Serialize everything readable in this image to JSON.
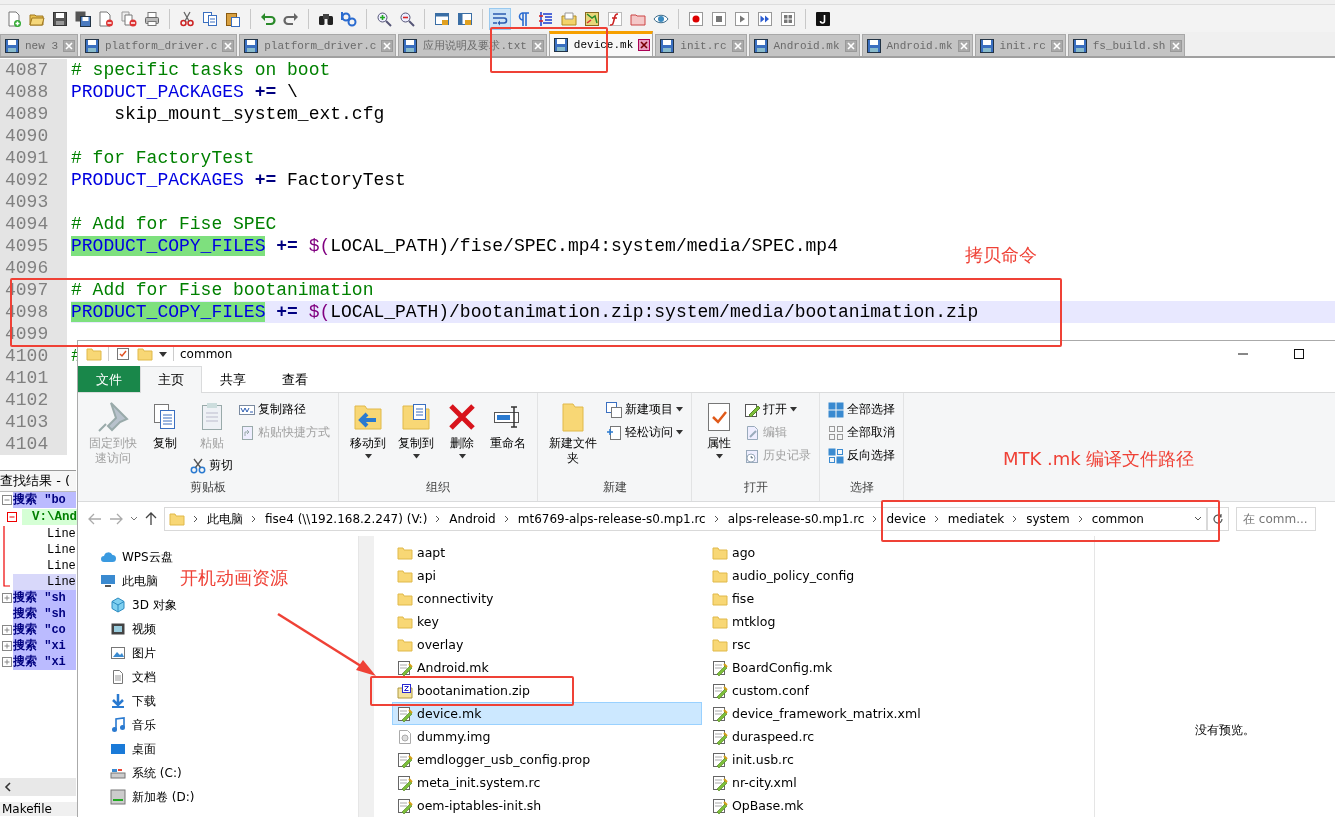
{
  "toolbar": {
    "wrap_toggle_on": true
  },
  "editor": {
    "tabs": [
      {
        "label": "new 3",
        "selected": false
      },
      {
        "label": "platform_driver.c",
        "selected": false
      },
      {
        "label": "platform_driver.c",
        "selected": false
      },
      {
        "label": "应用说明及要求.txt",
        "selected": false
      },
      {
        "label": "device.mk",
        "selected": true
      },
      {
        "label": "init.rc",
        "selected": false
      },
      {
        "label": "Android.mk",
        "selected": false
      },
      {
        "label": "Android.mk",
        "selected": false
      },
      {
        "label": "init.rc",
        "selected": false
      },
      {
        "label": "fs_build.sh",
        "selected": false
      }
    ],
    "lines": [
      {
        "number": "4087",
        "current": false,
        "segments": [
          {
            "kind": "comment",
            "text": "# specific tasks on boot"
          }
        ]
      },
      {
        "number": "4088",
        "current": false,
        "segments": [
          {
            "kind": "keyword",
            "text": "PRODUCT_PACKAGES"
          },
          {
            "kind": "operator",
            "text": "+="
          },
          {
            "kind": "plain",
            "text": "\\"
          }
        ]
      },
      {
        "number": "4089",
        "current": false,
        "segments": [
          {
            "kind": "plain",
            "text": "    skip_mount_system_ext.cfg"
          }
        ]
      },
      {
        "number": "4090",
        "current": false
      },
      {
        "number": "4091",
        "current": false,
        "segments": [
          {
            "kind": "comment",
            "text": "# for FactoryTest"
          }
        ]
      },
      {
        "number": "4092",
        "current": false,
        "segments": [
          {
            "kind": "keyword",
            "text": "PRODUCT_PACKAGES"
          },
          {
            "kind": "operator",
            "text": "+="
          },
          {
            "kind": "plain",
            "text": "FactoryTest"
          }
        ]
      },
      {
        "number": "4093",
        "current": false
      },
      {
        "number": "4094",
        "current": false,
        "segments": [
          {
            "kind": "comment",
            "text": "# Add for Fise SPEC"
          }
        ]
      },
      {
        "number": "4095",
        "current": false,
        "segments": [
          {
            "kind": "marked",
            "text": "PRODUCT_COPY_FILES"
          },
          {
            "kind": "operator",
            "text": "+="
          },
          {
            "kind": "macro",
            "text": "$("
          },
          {
            "kind": "plain",
            "text": "LOCAL_PATH)/fise/SPEC.mp4:system/media/SPEC.mp4"
          }
        ]
      },
      {
        "number": "4096",
        "current": false
      },
      {
        "number": "4097",
        "current": false,
        "segments": [
          {
            "kind": "comment",
            "text": "# Add for Fise bootanimation"
          }
        ]
      },
      {
        "number": "4098",
        "current": true,
        "segments": [
          {
            "kind": "marked",
            "text": "PRODUCT_COPY_FILES"
          },
          {
            "kind": "operator",
            "text": "+="
          },
          {
            "kind": "macro",
            "text": "$("
          },
          {
            "kind": "plain",
            "text": "LOCAL_PATH)/bootanimation.zip:system/media/bootanimation.zip"
          }
        ]
      },
      {
        "number": "4099",
        "current": false
      },
      {
        "number": "4100",
        "current": false,
        "segments": [
          {
            "kind": "comment",
            "text": "#"
          }
        ]
      },
      {
        "number": "4101",
        "current": false
      },
      {
        "number": "4102",
        "current": false
      },
      {
        "number": "4103",
        "current": false
      },
      {
        "number": "4104",
        "current": false
      }
    ]
  },
  "find_results": {
    "title": "查找结果 - (",
    "searches": [
      {
        "text": "搜索 \"bo",
        "expandable": true,
        "expanded": true,
        "children": [
          {
            "text": "V:\\And",
            "expanded": true,
            "children": [
              {
                "text": "Line",
                "current": false
              },
              {
                "text": "Line",
                "current": false
              },
              {
                "text": "Line",
                "current": false
              },
              {
                "text": "Line",
                "current": true
              }
            ]
          }
        ]
      },
      {
        "text": "搜索 \"sh",
        "expandable": true,
        "expanded": false
      },
      {
        "text": "搜索 \"sh",
        "expandable": false
      },
      {
        "text": "搜索 \"co",
        "expandable": true,
        "expanded": false
      },
      {
        "text": "搜索 \"xi",
        "expandable": true,
        "expanded": false
      },
      {
        "text": "搜索 \"xi",
        "expandable": true,
        "expanded": false
      }
    ]
  },
  "status_bar": {
    "text": "Makefile"
  },
  "explorer": {
    "title": "common",
    "ribbon_tabs": [
      {
        "label": "文件",
        "kind": "menu",
        "selected": false
      },
      {
        "label": "主页",
        "kind": "tab",
        "selected": true
      },
      {
        "label": "共享",
        "kind": "tab",
        "selected": false
      },
      {
        "label": "查看",
        "kind": "tab",
        "selected": false
      }
    ],
    "ribbon_groups": [
      {
        "label": "剪贴板",
        "columns": [
          {
            "items": [
              {
                "label": "固定到快速访问",
                "kind": "large",
                "disabled": true,
                "dropdown": false
              }
            ]
          },
          {
            "items": [
              {
                "label": "复制",
                "kind": "large",
                "disabled": false,
                "dropdown": false
              }
            ]
          },
          {
            "items": [
              {
                "label": "粘贴",
                "kind": "large",
                "disabled": true,
                "dropdown": false
              },
              {
                "label": "剪切",
                "kind": "small",
                "disabled": false,
                "dropdown": false
              }
            ]
          },
          {
            "items": [
              {
                "label": "复制路径",
                "kind": "small",
                "disabled": false,
                "dropdown": false
              },
              {
                "label": "粘贴快捷方式",
                "kind": "small",
                "disabled": true,
                "dropdown": false
              }
            ]
          }
        ]
      },
      {
        "label": "组织",
        "columns": [
          {
            "items": [
              {
                "label": "移动到",
                "kind": "large",
                "disabled": false,
                "dropdown": true
              }
            ]
          },
          {
            "items": [
              {
                "label": "复制到",
                "kind": "large",
                "disabled": false,
                "dropdown": true
              }
            ]
          },
          {
            "items": [
              {
                "label": "删除",
                "kind": "large",
                "disabled": false,
                "dropdown": true
              }
            ]
          },
          {
            "items": [
              {
                "label": "重命名",
                "kind": "large",
                "disabled": false,
                "dropdown": false
              }
            ]
          }
        ]
      },
      {
        "label": "新建",
        "columns": [
          {
            "items": [
              {
                "label": "新建文件夹",
                "kind": "large",
                "disabled": false,
                "dropdown": false
              }
            ]
          },
          {
            "items": [
              {
                "label": "新建项目",
                "kind": "small",
                "disabled": false,
                "dropdown": true
              },
              {
                "label": "轻松访问",
                "kind": "small",
                "disabled": false,
                "dropdown": true
              }
            ]
          }
        ]
      },
      {
        "label": "打开",
        "columns": [
          {
            "items": [
              {
                "label": "属性",
                "kind": "large",
                "disabled": false,
                "dropdown": true
              }
            ]
          },
          {
            "items": [
              {
                "label": "打开",
                "kind": "small",
                "disabled": false,
                "dropdown": true
              },
              {
                "label": "编辑",
                "kind": "small",
                "disabled": true,
                "dropdown": false
              },
              {
                "label": "历史记录",
                "kind": "small",
                "disabled": true,
                "dropdown": false
              }
            ]
          }
        ]
      },
      {
        "label": "选择",
        "columns": [
          {
            "items": [
              {
                "label": "全部选择",
                "kind": "small",
                "disabled": false,
                "dropdown": false
              },
              {
                "label": "全部取消",
                "kind": "small",
                "disabled": false,
                "dropdown": false
              },
              {
                "label": "反向选择",
                "kind": "small",
                "disabled": false,
                "dropdown": false
              }
            ]
          }
        ]
      }
    ],
    "breadcrumbs": [
      "此电脑",
      "fise4 (\\\\192.168.2.247) (V:)",
      "Android",
      "mt6769-alps-release-s0.mp1.rc",
      "alps-release-s0.mp1.rc",
      "device",
      "mediatek",
      "system",
      "common"
    ],
    "search": {
      "placeholder": "在 comm..."
    },
    "nav": [
      {
        "label": "WPS云盘"
      },
      {
        "label": "此电脑",
        "children": [
          {
            "label": "3D 对象"
          },
          {
            "label": "视频"
          },
          {
            "label": "图片"
          },
          {
            "label": "文档"
          },
          {
            "label": "下载"
          },
          {
            "label": "音乐"
          },
          {
            "label": "桌面"
          },
          {
            "label": "系统 (C:)"
          },
          {
            "label": "新加卷 (D:)"
          }
        ]
      }
    ],
    "files": [
      {
        "name": "aapt",
        "kind": "folder",
        "selected": false
      },
      {
        "name": "ago",
        "kind": "folder",
        "selected": false
      },
      {
        "name": "api",
        "kind": "folder",
        "selected": false
      },
      {
        "name": "audio_policy_config",
        "kind": "folder",
        "selected": false
      },
      {
        "name": "connectivity",
        "kind": "folder",
        "selected": false
      },
      {
        "name": "fise",
        "kind": "folder",
        "selected": false
      },
      {
        "name": "key",
        "kind": "folder",
        "selected": false
      },
      {
        "name": "mtklog",
        "kind": "folder",
        "selected": false
      },
      {
        "name": "overlay",
        "kind": "folder",
        "selected": false
      },
      {
        "name": "rsc",
        "kind": "folder",
        "selected": false
      },
      {
        "name": "Android.mk",
        "kind": "text",
        "selected": false
      },
      {
        "name": "BoardConfig.mk",
        "kind": "text",
        "selected": false
      },
      {
        "name": "bootanimation.zip",
        "kind": "zip",
        "selected": false
      },
      {
        "name": "custom.conf",
        "kind": "text",
        "selected": false
      },
      {
        "name": "device.mk",
        "kind": "text",
        "selected": true
      },
      {
        "name": "device_framework_matrix.xml",
        "kind": "text",
        "selected": false
      },
      {
        "name": "dummy.img",
        "kind": "image",
        "selected": false
      },
      {
        "name": "duraspeed.rc",
        "kind": "text",
        "selected": false
      },
      {
        "name": "emdlogger_usb_config.prop",
        "kind": "text",
        "selected": false
      },
      {
        "name": "init.usb.rc",
        "kind": "text",
        "selected": false
      },
      {
        "name": "meta_init.system.rc",
        "kind": "text",
        "selected": false
      },
      {
        "name": "nr-city.xml",
        "kind": "text",
        "selected": false
      },
      {
        "name": "oem-iptables-init.sh",
        "kind": "text",
        "selected": false
      },
      {
        "name": "OpBase.mk",
        "kind": "text",
        "selected": false
      }
    ],
    "preview_text": "没有预览。"
  },
  "annotations": [
    {
      "text": "拷贝命令"
    },
    {
      "text": "MTK .mk 编译文件路径"
    },
    {
      "text": "开机动画资源"
    }
  ]
}
